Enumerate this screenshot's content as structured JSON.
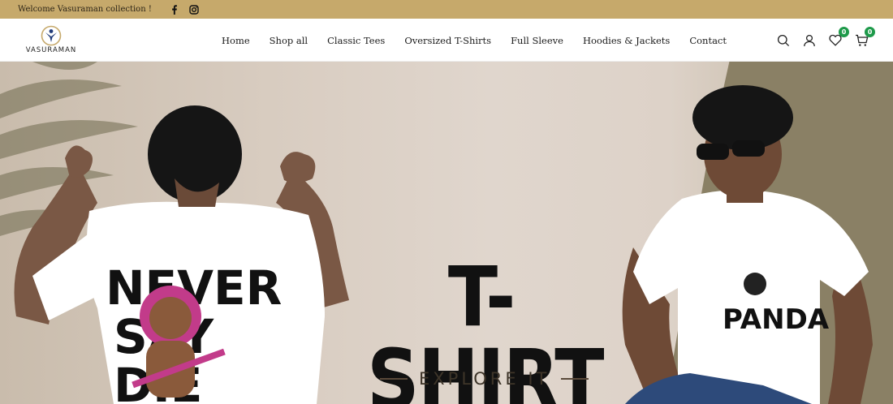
{
  "topbar": {
    "welcome": "Welcome Vasuraman collection !",
    "social": [
      {
        "name": "facebook-icon"
      },
      {
        "name": "instagram-icon"
      }
    ]
  },
  "header": {
    "brand": "VASURAMAN",
    "nav": [
      {
        "label": "Home"
      },
      {
        "label": "Shop all"
      },
      {
        "label": "Classic Tees"
      },
      {
        "label": "Oversized T-Shirts"
      },
      {
        "label": "Full Sleeve"
      },
      {
        "label": "Hoodies & Jackets"
      },
      {
        "label": "Contact"
      }
    ],
    "wishlist_count": "0",
    "cart_count": "0"
  },
  "hero": {
    "title": "T-SHIRT",
    "subtitle": "EXPLORE IT",
    "shirt_left_text": "NEVER SAY DIE",
    "shirt_right_text": "PANDA"
  },
  "colors": {
    "topbar": "#c6a96b",
    "badge": "#1e9a4a",
    "accent_olive": "#8a8065"
  }
}
